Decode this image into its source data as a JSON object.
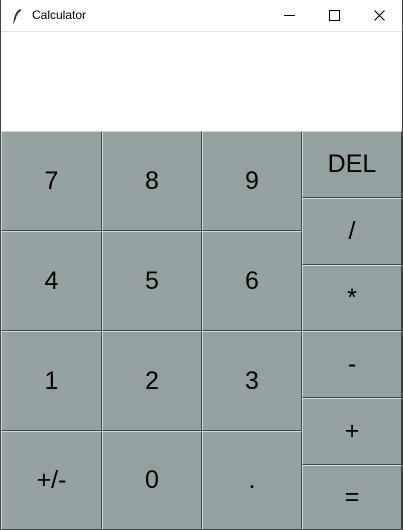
{
  "window": {
    "title": "Calculator"
  },
  "display": {
    "value": ""
  },
  "keys": {
    "k7": "7",
    "k8": "8",
    "k9": "9",
    "del": "DEL",
    "divide": "/",
    "k4": "4",
    "k5": "5",
    "k6": "6",
    "multiply": "*",
    "minus": "-",
    "k1": "1",
    "k2": "2",
    "k3": "3",
    "plus": "+",
    "negate": "+/-",
    "k0": "0",
    "dot": ".",
    "equals": "="
  },
  "colors": {
    "button_face": "#95a1a1",
    "display_bg": "#ffffff"
  },
  "icons": [
    "feather-icon",
    "minimize-icon",
    "maximize-icon",
    "close-icon"
  ]
}
